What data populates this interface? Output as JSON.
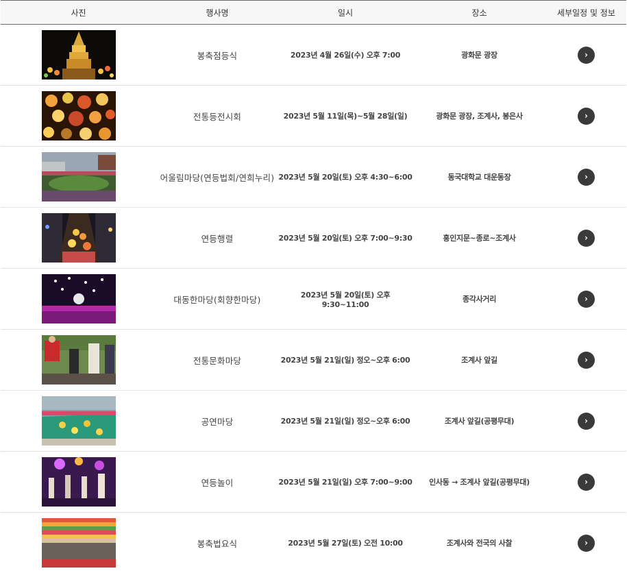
{
  "headers": {
    "photo": "사진",
    "name": "행사명",
    "date": "일시",
    "place": "장소",
    "detail": "세부일정 및 정보"
  },
  "rows": [
    {
      "name": "봉축점등식",
      "date": "2023년 4월 26일(수) 오후 7:00",
      "place": "광화문 광장",
      "detail_icon": "chevron-right-icon"
    },
    {
      "name": "전통등전시회",
      "date": "2023년 5월 11일(목)~5월 28일(일)",
      "place": "광화문 광장, 조계사, 봉은사",
      "detail_icon": "chevron-right-icon"
    },
    {
      "name": "어울림마당(연등법회/연희누리)",
      "date": "2023년 5월 20일(토) 오후 4:30~6:00",
      "place": "동국대학교 대운동장",
      "detail_icon": "chevron-right-icon"
    },
    {
      "name": "연등행렬",
      "date": "2023년 5월 20일(토) 오후 7:00~9:30",
      "place": "흥인지문~종로~조계사",
      "detail_icon": "chevron-right-icon"
    },
    {
      "name": "대동한마당(회향한마당)",
      "date": "2023년 5월 20일(토) 오후 9:30~11:00",
      "place": "종각사거리",
      "detail_icon": "chevron-right-icon"
    },
    {
      "name": "전통문화마당",
      "date": "2023년 5월 21일(일) 정오~오후 6:00",
      "place": "조계사 앞길",
      "detail_icon": "chevron-right-icon"
    },
    {
      "name": "공연마당",
      "date": "2023년 5월 21일(일) 정오~오후 6:00",
      "place": "조계사 앞길(공평무대)",
      "detail_icon": "chevron-right-icon"
    },
    {
      "name": "연등놀이",
      "date": "2023년 5월 21일(일) 오후 7:00~9:00",
      "place": "인사동 → 조계사 앞길(공평무대)",
      "detail_icon": "chevron-right-icon"
    },
    {
      "name": "봉축법요식",
      "date": "2023년 5월 27일(토) 오전 10:00",
      "place": "조계사와 전국의 사찰",
      "detail_icon": "chevron-right-icon"
    }
  ],
  "detail_glyph": "›"
}
